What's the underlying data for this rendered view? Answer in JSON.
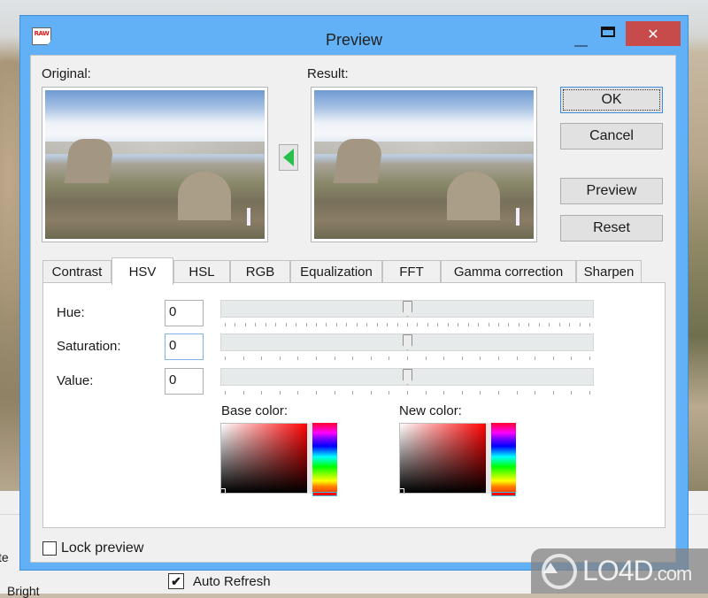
{
  "window": {
    "title": "Preview",
    "app_icon_text": "RAW",
    "controls": {
      "minimize": "minimize",
      "maximize": "maximize",
      "close": "✕"
    }
  },
  "previews": {
    "original_label": "Original:",
    "result_label": "Result:",
    "copy_arrow": "copy-result-to-original"
  },
  "buttons": {
    "ok": "OK",
    "cancel": "Cancel",
    "preview": "Preview",
    "reset": "Reset"
  },
  "tabs": [
    {
      "label": "Contrast",
      "active": false
    },
    {
      "label": "HSV",
      "active": true
    },
    {
      "label": "HSL",
      "active": false
    },
    {
      "label": "RGB",
      "active": false
    },
    {
      "label": "Equalization",
      "active": false
    },
    {
      "label": "FFT",
      "active": false
    },
    {
      "label": "Gamma correction",
      "active": false
    },
    {
      "label": "Sharpen",
      "active": false
    }
  ],
  "hsv": {
    "fields": [
      {
        "label": "Hue:",
        "value": "0",
        "slider_position_fraction": 0.5,
        "ticks": 37
      },
      {
        "label": "Saturation:",
        "value": "0",
        "slider_position_fraction": 0.5,
        "ticks": 21
      },
      {
        "label": "Value:",
        "value": "0",
        "slider_position_fraction": 0.5,
        "ticks": 21
      }
    ],
    "base_color_label": "Base color:",
    "new_color_label": "New color:",
    "base_color_hue": "#ff0000",
    "new_color_hue": "#ff0000"
  },
  "lock_preview": {
    "label": "Lock preview",
    "checked": false
  },
  "background_app": {
    "auto_refresh": {
      "label": "Auto Refresh",
      "checked": true
    },
    "partial_text_1": "te",
    "partial_text_2": "Bright"
  },
  "watermark": {
    "brand": "LO4D",
    "suffix": ".com"
  },
  "colors": {
    "titlebar": "#62b0f6",
    "close_button": "#c74b4b",
    "arrow_green": "#28c04a",
    "focus_border": "#3c8ee0"
  }
}
